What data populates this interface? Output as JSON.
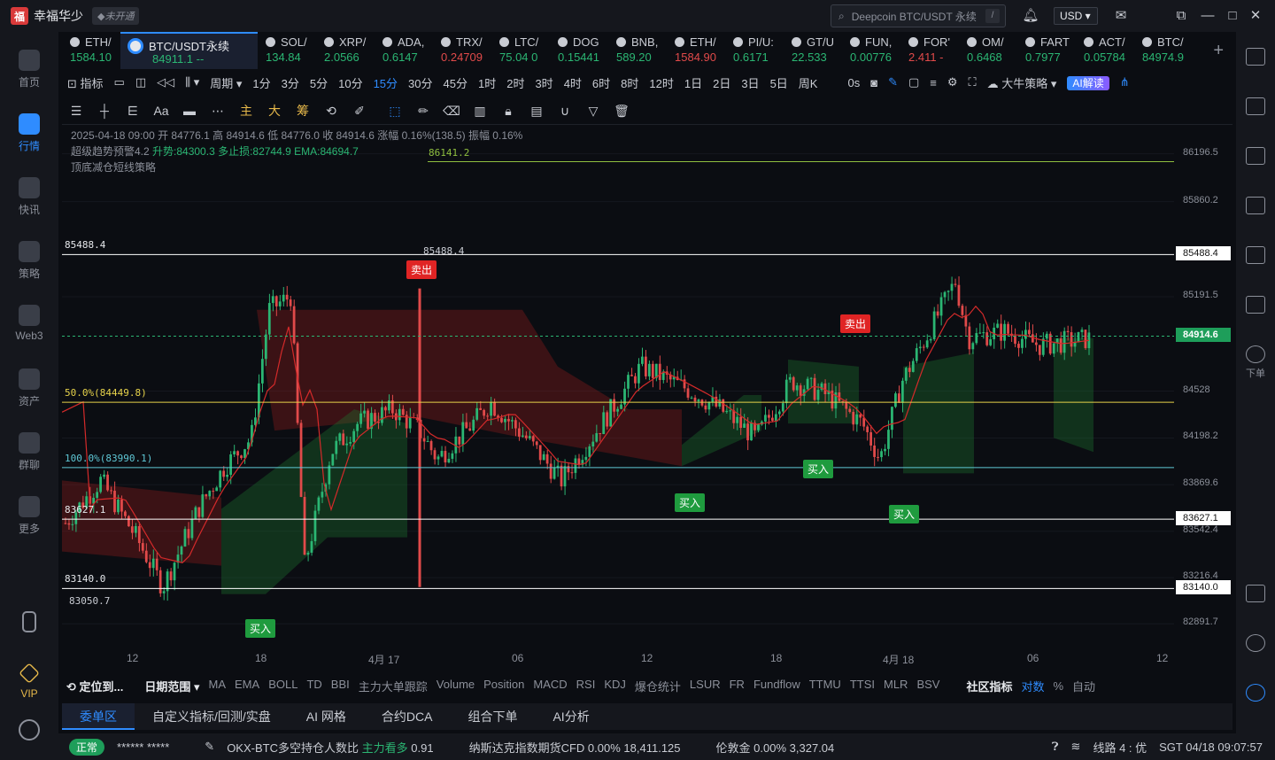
{
  "titlebar": {
    "username": "幸福华少",
    "vip_tag": "未开通",
    "search_placeholder": "Deepcoin BTC/USDT 永续",
    "search_kbd": "/",
    "currency": "USD"
  },
  "leftnav": [
    {
      "label": "首页",
      "name": "nav-home"
    },
    {
      "label": "行情",
      "name": "nav-market"
    },
    {
      "label": "快讯",
      "name": "nav-news"
    },
    {
      "label": "策略",
      "name": "nav-strategy"
    },
    {
      "label": "Web3",
      "name": "nav-web3"
    },
    {
      "label": "资产",
      "name": "nav-assets"
    },
    {
      "label": "群聊",
      "name": "nav-chat"
    },
    {
      "label": "更多",
      "name": "nav-more"
    },
    {
      "label": "VIP",
      "name": "nav-vip"
    }
  ],
  "rightnav": {
    "order_label": "下单"
  },
  "tickers": [
    {
      "sym": "ETH/",
      "px": "1584.10",
      "dir": "up"
    },
    {
      "sym": "BTC/USDT永续",
      "px": "84911.1  --",
      "dir": "up",
      "main": true
    },
    {
      "sym": "SOL/",
      "px": "134.84",
      "dir": "up"
    },
    {
      "sym": "XRP/",
      "px": "2.0566",
      "dir": "up"
    },
    {
      "sym": "ADA,",
      "px": "0.6147",
      "dir": "up"
    },
    {
      "sym": "TRX/",
      "px": "0.24709",
      "dir": "down"
    },
    {
      "sym": "LTC/",
      "px": "75.04 0",
      "dir": "up"
    },
    {
      "sym": "DOG",
      "px": "0.15441",
      "dir": "up"
    },
    {
      "sym": "BNB,",
      "px": "589.20",
      "dir": "up"
    },
    {
      "sym": "ETH/",
      "px": "1584.90",
      "dir": "down"
    },
    {
      "sym": "PI/U:",
      "px": "0.6171",
      "dir": "up"
    },
    {
      "sym": "GT/U",
      "px": "22.533",
      "dir": "up"
    },
    {
      "sym": "FUN,",
      "px": "0.00776",
      "dir": "up"
    },
    {
      "sym": "FOR'",
      "px": "2.411  -",
      "dir": "down"
    },
    {
      "sym": "OM/",
      "px": "0.6468",
      "dir": "up"
    },
    {
      "sym": "FART",
      "px": "0.7977",
      "dir": "up"
    },
    {
      "sym": "ACT/",
      "px": "0.05784",
      "dir": "up"
    },
    {
      "sym": "BTC/",
      "px": "84974.9",
      "dir": "up"
    }
  ],
  "periodbar": {
    "indicator": "指标",
    "period": "周期",
    "periods": [
      "1分",
      "3分",
      "5分",
      "10分",
      "15分",
      "30分",
      "45分",
      "1时",
      "2时",
      "3时",
      "4时",
      "6时",
      "8时",
      "12时",
      "1日",
      "2日",
      "3日",
      "5日",
      "周K"
    ],
    "active": "15分",
    "zero_s": "0s",
    "strategy": "大牛策略",
    "ai": "AI解读"
  },
  "drawbar": {
    "zhu": "主",
    "da": "大",
    "chou": "筹",
    "aa": "Aa"
  },
  "legend": {
    "line1": "2025-04-18 09:00  开 84776.1  高 84914.6  低 84776.0  收 84914.6  涨幅 0.16%(138.5)  振幅 0.16%",
    "line2_name": "超级趋势预警4.2",
    "line2_vals": "升势:84300.3  多止损:82744.9  EMA:84694.7",
    "line3": "顶底减仓短线策略"
  },
  "chart_data": {
    "type": "candlestick",
    "symbol": "BTC/USDT永续",
    "interval": "15分",
    "yaxis_ticks": [
      86196.5,
      85860.2,
      85191.5,
      84528.0,
      84198.2,
      83869.6,
      83542.4,
      83216.4,
      82891.7
    ],
    "xaxis_ticks": [
      "12",
      "18",
      "4月 17",
      "06",
      "12",
      "18",
      "4月 18",
      "06",
      "12"
    ],
    "levels": [
      {
        "label": "86141.2",
        "value": 86141.2,
        "color": "#8fbf3f"
      },
      {
        "label": "85488.4",
        "value": 85488.4,
        "color": "#ffffff"
      },
      {
        "label": "50.0%(84449.8)",
        "value": 84449.8,
        "color": "#e6d24a"
      },
      {
        "label": "100.0%(83990.1)",
        "value": 83990.1,
        "color": "#5fc8d6"
      },
      {
        "label": "83627.1",
        "value": 83627.1,
        "color": "#ffffff"
      },
      {
        "label": "83140.0",
        "value": 83140.0,
        "color": "#ffffff"
      }
    ],
    "current_price": "84914.6",
    "high_mark": "85488.4",
    "low_mark": "83050.7",
    "signals": [
      {
        "label": "买入",
        "type": "buy"
      },
      {
        "label": "卖出",
        "type": "sell"
      },
      {
        "label": "买入",
        "type": "buy"
      },
      {
        "label": "买入",
        "type": "buy"
      },
      {
        "label": "卖出",
        "type": "sell"
      },
      {
        "label": "买入",
        "type": "buy"
      }
    ]
  },
  "indbar": {
    "locate": "定位到...",
    "date_range": "日期范围",
    "items": [
      "MA",
      "EMA",
      "BOLL",
      "TD",
      "BBI",
      "主力大单跟踪",
      "Volume",
      "Position",
      "MACD",
      "RSI",
      "KDJ",
      "爆仓统计",
      "LSUR",
      "FR",
      "Fundflow",
      "TTMU",
      "TTSI",
      "MLR",
      "BSV"
    ],
    "community": "社区指标",
    "log": "对数",
    "pct": "%",
    "auto": "自动"
  },
  "bottomtabs": [
    "委单区",
    "自定义指标/回测/实盘",
    "AI 网格",
    "合约DCA",
    "组合下单",
    "AI分析"
  ],
  "statusbar": {
    "status": "正常",
    "masked": "****** *****",
    "item1_name": "OKX-BTC多空持仓人数比",
    "item1_tag": "主力看多",
    "item1_val": "0.91",
    "item2_name": "纳斯达克指数期货CFD",
    "item2_pct": "0.00%",
    "item2_val": "18,411.125",
    "item3_name": "伦敦金",
    "item3_pct": "0.00%",
    "item3_val": "3,327.04",
    "line": "线路 4 : 优",
    "time": "SGT 04/18 09:07:57"
  }
}
